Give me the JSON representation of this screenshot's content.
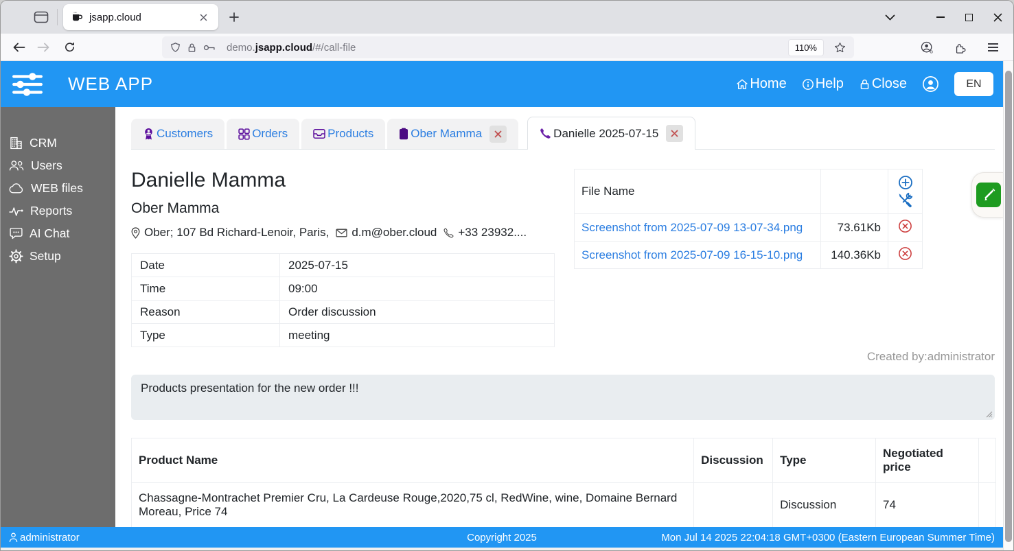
{
  "browser": {
    "tab_title": "jsapp.cloud",
    "url_prefix": "demo.",
    "url_domain": "jsapp.cloud",
    "url_path": "/#/call-file",
    "zoom_level": "110%"
  },
  "app_header": {
    "title": "WEB APP",
    "home": "Home",
    "help": "Help",
    "close": "Close",
    "language": "EN"
  },
  "sidebar": {
    "items": [
      {
        "label": "CRM",
        "icon": "building-icon"
      },
      {
        "label": "Users",
        "icon": "users-icon"
      },
      {
        "label": "WEB files",
        "icon": "cloud-icon"
      },
      {
        "label": "Reports",
        "icon": "activity-icon"
      },
      {
        "label": "AI Chat",
        "icon": "chat-icon"
      },
      {
        "label": "Setup",
        "icon": "gear-icon"
      }
    ]
  },
  "tabs": [
    {
      "label": "Customers",
      "icon": "customer-badge-icon",
      "closable": false,
      "active": false
    },
    {
      "label": "Orders",
      "icon": "grid-icon",
      "closable": false,
      "active": false
    },
    {
      "label": "Products",
      "icon": "inbox-icon",
      "closable": false,
      "active": false
    },
    {
      "label": "Ober Mamma",
      "icon": "clipboard-icon",
      "closable": true,
      "active": false
    },
    {
      "label": "Danielle 2025-07-15",
      "icon": "phone-icon",
      "closable": true,
      "active": true
    }
  ],
  "call": {
    "contact_name": "Danielle Mamma",
    "company_name": "Ober Mamma",
    "address": "Ober; 107 Bd Richard-Lenoir, Paris,",
    "email": "d.m@ober.cloud",
    "phone": "+33 23932....",
    "details": [
      {
        "label": "Date",
        "value": "2025-07-15"
      },
      {
        "label": "Time",
        "value": "09:00"
      },
      {
        "label": "Reason",
        "value": "Order discussion"
      },
      {
        "label": "Type",
        "value": "meeting"
      }
    ],
    "created_by": "Created by:administrator",
    "note": "Products presentation for the new order !!!"
  },
  "files": {
    "header": "File Name",
    "rows": [
      {
        "name": "Screenshot from 2025-07-09 13-07-34.png",
        "size": "73.61Kb"
      },
      {
        "name": "Screenshot from 2025-07-09 16-15-10.png",
        "size": "140.36Kb"
      }
    ]
  },
  "products": {
    "columns": [
      "Product Name",
      "Discussion",
      "Type",
      "Negotiated price"
    ],
    "rows": [
      {
        "name": "Chassagne-Montrachet Premier Cru, La Cardeuse Rouge,2020,75 cl, RedWine, wine, Domaine Bernard Moreau, Price 74",
        "discussion": "",
        "type": "Discussion",
        "price": "74"
      }
    ]
  },
  "footer": {
    "user": "administrator",
    "copyright": "Copyright 2025",
    "datetime": "Mon Jul 14 2025 22:04:18 GMT+0300 (Eastern European Summer Time)"
  },
  "colors": {
    "header_blue": "#2196f3",
    "sidebar_gray": "#6d6d6d",
    "link_blue": "#2a7de1",
    "icon_purple": "#5c0f9d",
    "danger_red": "#cd3d3d",
    "edit_green": "#1e9b20",
    "action_blue": "#1b6ec2"
  }
}
